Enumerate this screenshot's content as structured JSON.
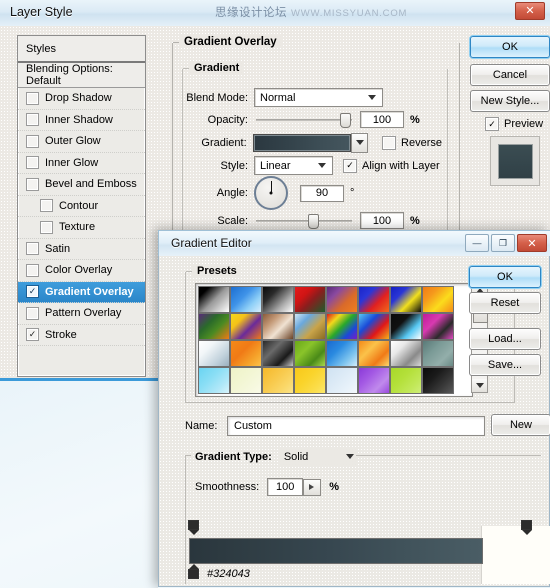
{
  "desktop": {
    "watermark_cn": "思缘设计论坛",
    "watermark_url": "WWW.MISSYUAN.COM"
  },
  "layer_style": {
    "title": "Layer Style",
    "close_glyph": "✕",
    "styles_panel": {
      "header": "Styles",
      "blending_options": "Blending Options: Default",
      "items": [
        {
          "label": "Drop Shadow",
          "checked": false,
          "indent": false
        },
        {
          "label": "Inner Shadow",
          "checked": false,
          "indent": false
        },
        {
          "label": "Outer Glow",
          "checked": false,
          "indent": false
        },
        {
          "label": "Inner Glow",
          "checked": false,
          "indent": false
        },
        {
          "label": "Bevel and Emboss",
          "checked": false,
          "indent": false
        },
        {
          "label": "Contour",
          "checked": false,
          "indent": true
        },
        {
          "label": "Texture",
          "checked": false,
          "indent": true
        },
        {
          "label": "Satin",
          "checked": false,
          "indent": false
        },
        {
          "label": "Color Overlay",
          "checked": false,
          "indent": false
        },
        {
          "label": "Gradient Overlay",
          "checked": true,
          "indent": false,
          "selected": true
        },
        {
          "label": "Pattern Overlay",
          "checked": false,
          "indent": false
        },
        {
          "label": "Stroke",
          "checked": true,
          "indent": false
        }
      ],
      "check_glyph": "✓"
    },
    "gradient_overlay": {
      "group_title": "Gradient Overlay",
      "sub_title": "Gradient",
      "blend_mode_label": "Blend Mode:",
      "blend_mode_value": "Normal",
      "opacity_label": "Opacity:",
      "opacity_value": "100",
      "opacity_unit": "%",
      "gradient_label": "Gradient:",
      "gradient_preview_colors": [
        "#2b3840",
        "#45565e"
      ],
      "reverse_label": "Reverse",
      "reverse_checked": false,
      "style_label": "Style:",
      "style_value": "Linear",
      "align_label": "Align with Layer",
      "align_checked": true,
      "angle_label": "Angle:",
      "angle_value": "90",
      "angle_unit": "°",
      "scale_label": "Scale:",
      "scale_value": "100",
      "scale_unit": "%"
    },
    "buttons": {
      "ok": "OK",
      "cancel": "Cancel",
      "new_style": "New Style...",
      "preview_label": "Preview",
      "preview_checked": true,
      "check_glyph": "✓"
    }
  },
  "gradient_editor": {
    "title": "Gradient Editor",
    "minimize_glyph": "—",
    "maximize_glyph": "❐",
    "close_glyph": "✕",
    "presets_title": "Presets",
    "presets": [
      "linear-gradient(135deg,#000 0%,#000 18%,#9a9a9a 52%,#ffffff 100%)",
      "linear-gradient(135deg,#1d6fd0 0%,#3f93e8 40%,#8fd0f7 70%,#d8eefd 100%)",
      "linear-gradient(135deg,#0a0a0a 0%,#2a2a2a 30%,#b0b0b0 70%,#ffffff 100%)",
      "linear-gradient(135deg,#e41b1b 0%,#cf1414 32%,#8b1d1d 55%,#1d5c2c 100%)",
      "linear-gradient(135deg,#5a2b7a 0%,#8a4aa0 28%,#d96a2a 62%,#f07f1f 100%)",
      "linear-gradient(135deg,#1a25c9 0%,#2a36d8 30%,#e02020 62%,#f26a1c 100%)",
      "linear-gradient(135deg,#1420c4 0%,#2a36d6 30%,#f2e01c 62%,#0c0c0c 100%)",
      "linear-gradient(135deg,#f07a16 0%,#f59a1c 30%,#fbdc1c 62%,#f58a18 100%)",
      "linear-gradient(135deg,#5a2b7a 0%,#2a6a2a 35%,#4a8a22 60%,#f07a16 100%)",
      "linear-gradient(135deg,#f2d81c 0%,#f5c218 28%,#6a2a9a 60%,#f07a16 100%)",
      "linear-gradient(135deg,#8a5a3a 0%,#c49a78 30%,#f0e2d2 58%,#6a4226 100%)",
      "linear-gradient(135deg,#cfe6f5 0%,#6aa8dc 30%,#c9a44a 62%,#8a6a22 100%)",
      "linear-gradient(135deg,#e01818 0%,#f2d81c 25%,#2aa82a 50%,#1a4ad8 75%,#7a1ac9 100%)",
      "linear-gradient(135deg,#56c7f2 0%,#1a4ad8 35%,#e01818 65%,#f2b21c 100%)",
      "linear-gradient(135deg,#0a0a0a 0%,#111 35%,#56c7f2 68%,#ffffff 100%)",
      "linear-gradient(135deg,#c01a9a 0%,#d83ab0 35%,#2a2a2a 68%,#e04ac0 100%)",
      "linear-gradient(135deg,#ffffff 0%,#f2f6f8 30%,#c2d2dc 70%,#9ab0be 100%)",
      "linear-gradient(135deg,#f58a18 0%,#f07a16 40%,#f5a22a 72%,#fbc24a 100%)",
      "linear-gradient(135deg,#2a2a2a 0%,#6a6a6a 35%,#1a1a1a 70%,#c8c8c8 100%)",
      "linear-gradient(135deg,#6aa81a 0%,#8ac42a 35%,#4a8a18 70%,#a8d84a 100%)",
      "linear-gradient(135deg,#1a6ad0 0%,#2a8ae0 35%,#7ac2ee 70%,#d2ecfa 100%)",
      "linear-gradient(135deg,#f58a18 0%,#fbc24a 35%,#f07a16 70%,#fbd86a 100%)",
      "linear-gradient(135deg,#ffffff 0%,#e8e8e8 30%,#8a8a8a 70%,#d8d8d8 100%)",
      "linear-gradient(135deg,#5a7a78 0%,#7a9a96 35%,#93aeaa 70%,#6a8a86 100%)",
      "linear-gradient(135deg,#6ad4f2 0%,#8adef5 40%,#b2e8f8 75%,#d8f4fc 100%)",
      "linear-gradient(135deg,#eef2c8 0%,#f2f6d2 40%,#f6f8de 75%,#fafbe8 100%)",
      "linear-gradient(135deg,#f5b82a 0%,#f8c84a 40%,#fad86a 75%,#fce48a 100%)",
      "linear-gradient(135deg,#f8c81a 0%,#fad32a 40%,#fbdd4a 75%,#fce86a 100%)",
      "linear-gradient(135deg,#cfe2f2 0%,#dceaf6 40%,#e8f2fa 75%,#f4f8fc 100%)",
      "linear-gradient(135deg,#8a3ad8 0%,#a45ae4 35%,#c08aec 70%,#9a4ade 100%)",
      "linear-gradient(135deg,#a8d82a 0%,#b4e03a 40%,#c2e85a 75%,#cfee7a 100%)",
      "linear-gradient(135deg,#0a0a0a 0%,#1a1a1a 35%,#3a3a3a 70%,#5a5a5a 100%)"
    ],
    "buttons": {
      "ok": "OK",
      "reset": "Reset",
      "load": "Load...",
      "save": "Save...",
      "new": "New"
    },
    "name_label": "Name:",
    "name_value": "Custom",
    "gradient_type_label": "Gradient Type:",
    "gradient_type_value": "Solid",
    "smoothness_label": "Smoothness:",
    "smoothness_value": "100",
    "smoothness_unit": "%",
    "stop_color_label": "#324043",
    "gradient_bar_colors": [
      "#2a363d",
      "#4a5d65"
    ]
  }
}
